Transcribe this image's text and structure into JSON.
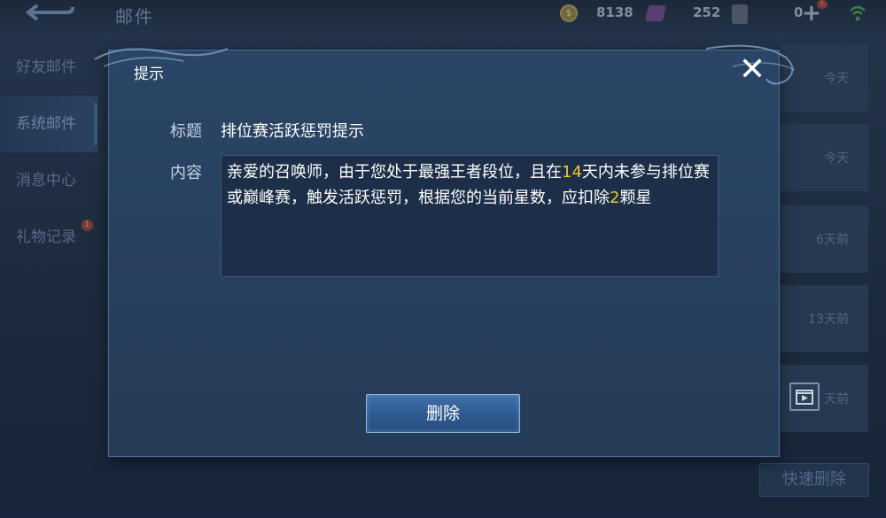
{
  "topbar": {
    "title": "邮件",
    "gold": "8138",
    "diamonds": "252",
    "tickets": "0",
    "badge": "!"
  },
  "sidebar": {
    "items": [
      {
        "label": "好友邮件"
      },
      {
        "label": "系统邮件"
      },
      {
        "label": "消息中心"
      },
      {
        "label": "礼物记录"
      }
    ],
    "badge": "1"
  },
  "list": {
    "times": [
      "今天",
      "今天",
      "6天前",
      "13天前",
      "天前"
    ]
  },
  "quick_delete_label": "快速删除",
  "dialog": {
    "header": "提示",
    "close": "✕",
    "subject_label": "标题",
    "subject": "排位赛活跃惩罚提示",
    "content_label": "内容",
    "content_parts": [
      "亲爱的召唤师，由于您处于最强王者段位，且在",
      "14",
      "天内未参与排位赛或巅峰赛，触发活跃惩罚，根据您的当前星数，应扣除",
      "2",
      "颗星"
    ],
    "delete_label": "删除"
  },
  "colors": {
    "highlight": "#f4c52a",
    "dialog_bg": "#2a4566",
    "button": "#2e5a90"
  }
}
